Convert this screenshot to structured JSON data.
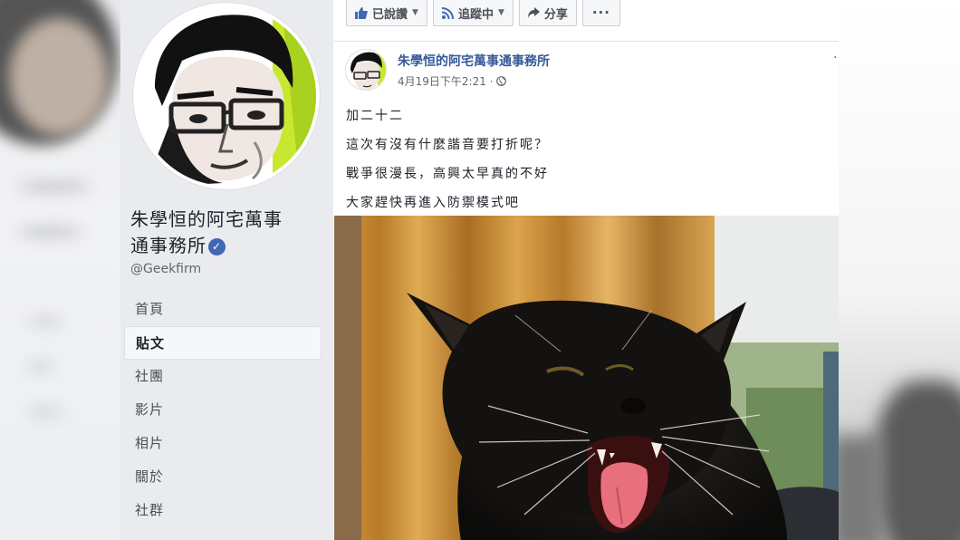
{
  "page": {
    "name_line1": "朱學恒的阿宅萬事",
    "name_line2": "通事務所",
    "handle": "@Geekfirm"
  },
  "nav": {
    "items": [
      {
        "label": "首頁"
      },
      {
        "label": "貼文"
      },
      {
        "label": "社團"
      },
      {
        "label": "影片"
      },
      {
        "label": "相片"
      },
      {
        "label": "關於"
      },
      {
        "label": "社群"
      }
    ],
    "active_index": 1
  },
  "actions": {
    "like_label": "已說讚",
    "follow_label": "追蹤中",
    "share_label": "分享",
    "more_label": "···"
  },
  "post": {
    "author": "朱學恒的阿宅萬事通事務所",
    "time": "4月19日下午2:21",
    "menu": "·",
    "lines": [
      "加二十二",
      "這次有沒有什麼諧音要打折呢？",
      "戰爭很漫長，高興太早真的不好",
      "大家趕快再進入防禦模式吧"
    ]
  },
  "icons": {
    "verified": "verified-badge-icon",
    "like": "thumbs-up-icon",
    "follow": "rss-icon",
    "share": "share-arrow-icon",
    "privacy": "globe-icon"
  },
  "colors": {
    "link_blue": "#365899",
    "fb_blue": "#4267b2",
    "sidebar_bg": "#e9ebee"
  }
}
